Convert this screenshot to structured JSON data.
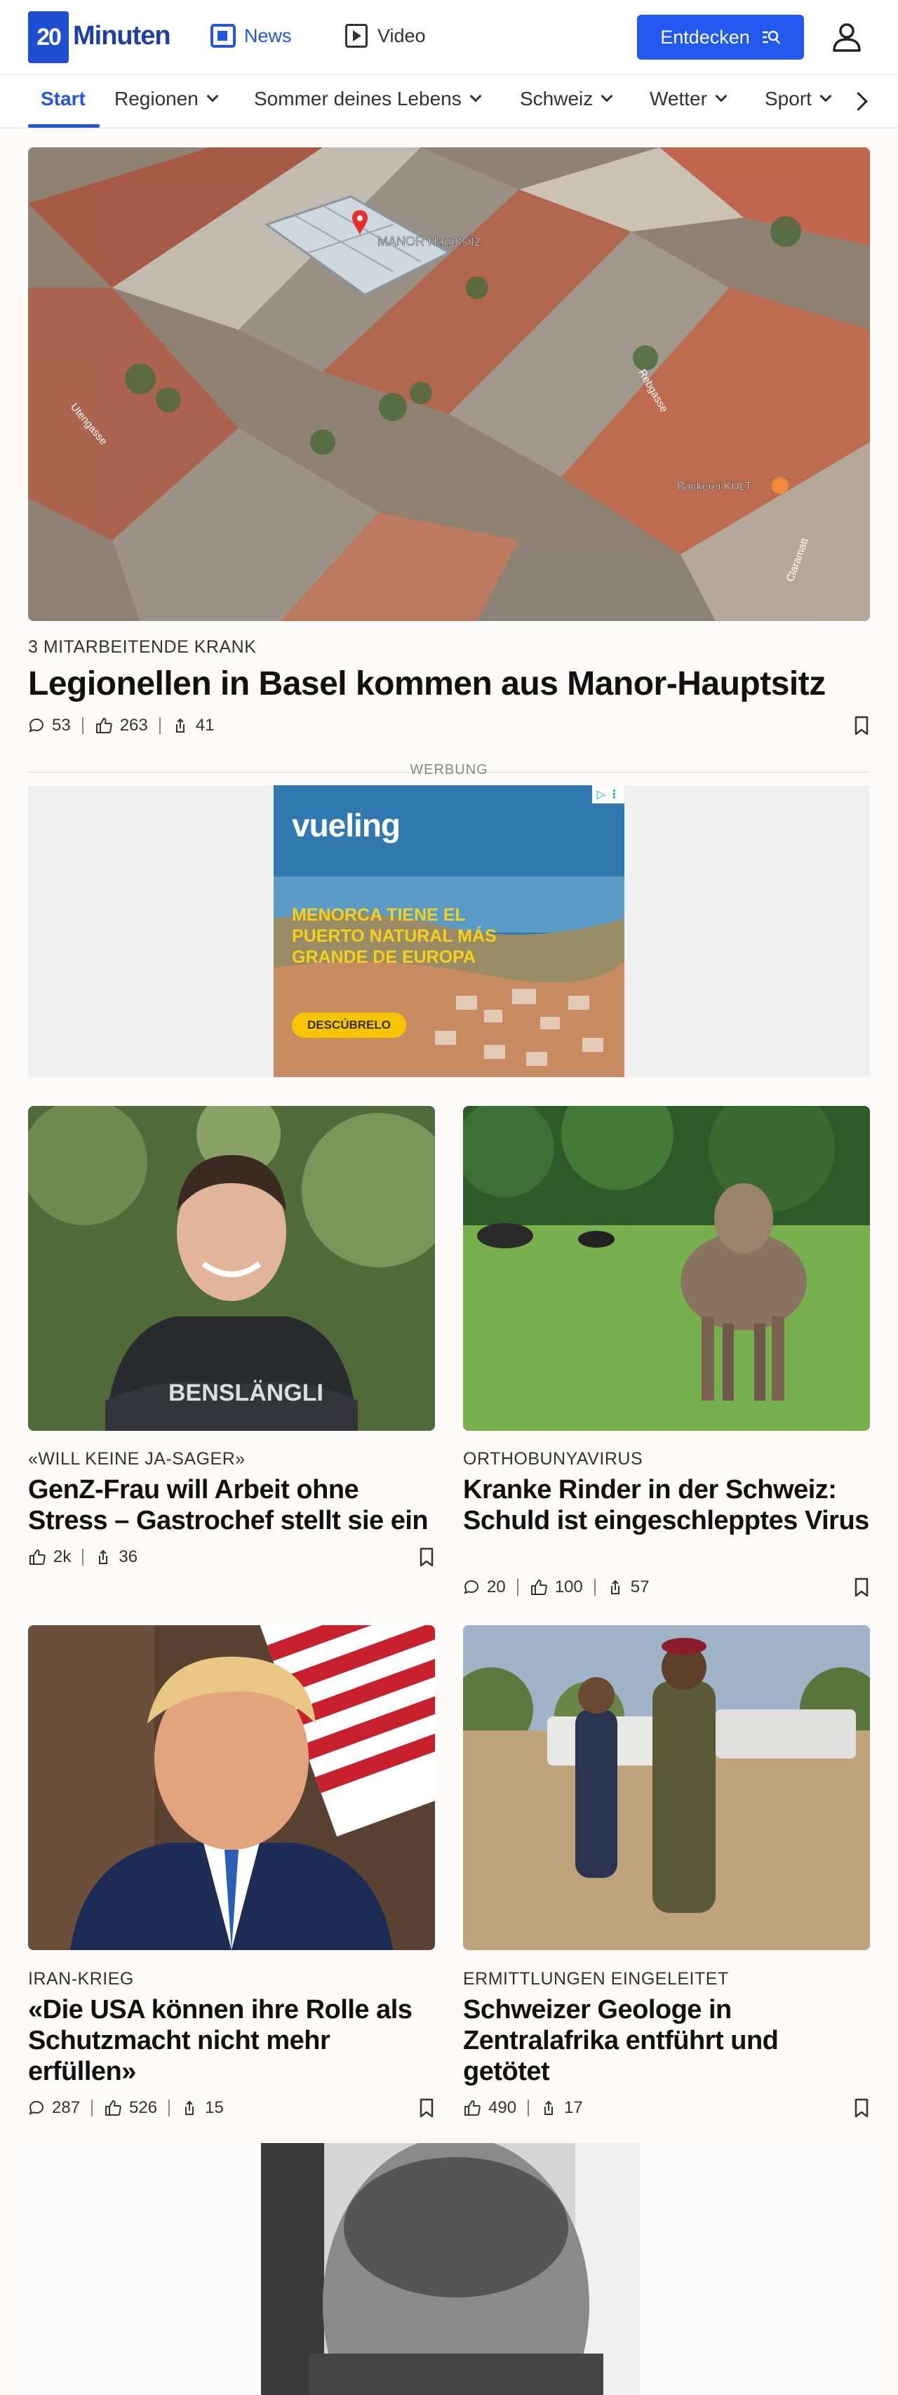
{
  "header": {
    "logo_mark": "20",
    "logo_text": "Minuten",
    "nav": [
      {
        "label": "News",
        "icon": "news-icon",
        "active": true
      },
      {
        "label": "Video",
        "icon": "play-icon",
        "active": false
      }
    ],
    "discover_button": "Entdecken",
    "profile_icon": "user-icon"
  },
  "categories": [
    {
      "label": "Start",
      "active": true
    },
    {
      "label": "Regionen",
      "dropdown": true
    },
    {
      "label": "Sommer deines Lebens",
      "dropdown": true
    },
    {
      "label": "Schweiz",
      "dropdown": true
    },
    {
      "label": "Wetter",
      "dropdown": true
    },
    {
      "label": "Sport",
      "dropdown": true
    }
  ],
  "hero": {
    "map_labels": [
      "MANOR Hauptsitz",
      "Bäckerei KULT",
      "Rebgasse",
      "Utengasse",
      "Claramatt"
    ],
    "kicker": "3 MITARBEITENDE KRANK",
    "headline": "Legionellen in Basel kommen aus Manor-Hauptsitz",
    "comments": "53",
    "likes": "263",
    "shares": "41"
  },
  "ad": {
    "label": "WERBUNG",
    "brand": "vueling",
    "text": "MENORCA TIENE EL PUERTO NATURAL MÁS GRANDE DE EUROPA",
    "cta": "DESCÚBRELO"
  },
  "articles": [
    {
      "kicker": "«WILL KEINE JA-SAGER»",
      "headline": "GenZ-Frau will Arbeit ohne Stress – Gastrochef stellt sie ein",
      "likes": "2k",
      "shares": "36"
    },
    {
      "kicker": "ORTHOBUNYAVIRUS",
      "headline": "Kranke Rinder in der Schweiz: Schuld ist eingeschlepptes Virus",
      "comments": "20",
      "likes": "100",
      "shares": "57"
    },
    {
      "kicker": "IRAN-KRIEG",
      "headline": "«Die USA können ihre Rolle als Schutzmacht nicht mehr erfüllen»",
      "comments": "287",
      "likes": "526",
      "shares": "15"
    },
    {
      "kicker": "ERMITTLUNGEN EINGELEITET",
      "headline": "Schweizer Geologe in Zentralafrika entführt und getötet",
      "likes": "490",
      "shares": "17"
    }
  ],
  "colors": {
    "brand": "#1f4fd1",
    "accent": "#2257f0"
  }
}
